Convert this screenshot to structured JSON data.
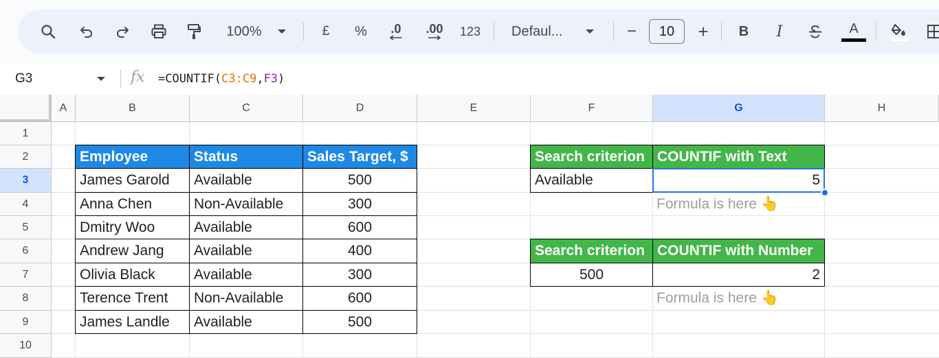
{
  "toolbar": {
    "zoom": "100%",
    "currency": "£",
    "percent": "%",
    "decrease_decimal": ".0",
    "increase_decimal": ".00",
    "number_format": "123",
    "font": "Defaul...",
    "font_size": "10",
    "minus": "−",
    "plus": "+",
    "bold": "B",
    "italic": "I",
    "text_color_letter": "A",
    "text_color": "#000000"
  },
  "formula_bar": {
    "cell_ref": "G3",
    "fx": "fx",
    "formula_prefix": "=COUNTIF(",
    "formula_range": "C3:C9",
    "formula_comma": ",",
    "formula_arg": "F3",
    "formula_suffix": ")",
    "range_color": "#e37400",
    "arg_color": "#8e24aa"
  },
  "columns": [
    "A",
    "B",
    "C",
    "D",
    "E",
    "F",
    "G",
    "H"
  ],
  "selected_column": "G",
  "rows": [
    "1",
    "2",
    "3",
    "4",
    "5",
    "6",
    "7",
    "8",
    "9",
    "10"
  ],
  "selected_row": "3",
  "employee_table": {
    "headers": [
      "Employee",
      "Status",
      "Sales Target, $"
    ],
    "rows": [
      [
        "James Garold",
        "Available",
        "500"
      ],
      [
        "Anna Chen",
        "Non-Available",
        "300"
      ],
      [
        "Dmitry Woo",
        "Available",
        "600"
      ],
      [
        "Andrew Jang",
        "Available",
        "400"
      ],
      [
        "Olivia Black",
        "Available",
        "300"
      ],
      [
        "Terence Trent",
        "Non-Available",
        "600"
      ],
      [
        "James Landle",
        "Available",
        "500"
      ]
    ],
    "header_color": "#1e88e5"
  },
  "text_lookup": {
    "header_criterion": "Search criterion",
    "header_result": "COUNTIF with Text",
    "criterion": "Available",
    "result": "5",
    "note": "Formula is here 👆"
  },
  "number_lookup": {
    "header_criterion": "Search criterion",
    "header_result": "COUNTIF with Number",
    "criterion": "500",
    "result": "2",
    "note": "Formula is here 👆"
  },
  "colors": {
    "green_header": "#43b649",
    "selection": "#1a73e8"
  }
}
